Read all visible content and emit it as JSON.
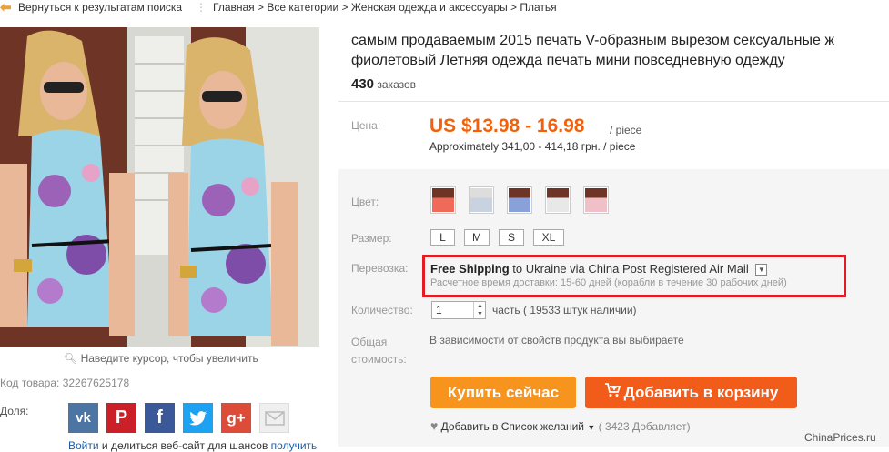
{
  "topbar": {
    "back_label": "Вернуться к результатам поиска",
    "breadcrumb": "Главная > Все категории > Женская одежда и аксессуары > Платья"
  },
  "gallery": {
    "zoom_hint": "Наведите курсор, чтобы увеличить",
    "code": "Код товара: 32267625178",
    "share_label": "Доля:",
    "share_icons": [
      "vk-icon",
      "pinterest-icon",
      "facebook-icon",
      "twitter-icon",
      "google-plus-icon",
      "email-icon"
    ],
    "bottom_login": "Войти",
    "bottom_text": " и делиться веб-сайт для шансов ",
    "bottom_get": "получить"
  },
  "product": {
    "title_line1": "самым продаваемым 2015 печать V-образным вырезом сексуальные ж",
    "title_line2": "фиолетовый Летняя одежда печать мини повседневную одежду",
    "orders_count": "430",
    "orders_label": "заказов"
  },
  "price": {
    "label": "Цена:",
    "value": "US $13.98 - 16.98",
    "unit": "/ piece",
    "approx": "Approximately 341,00 - 414,18 грн. / piece"
  },
  "options": {
    "color_label": "Цвет:",
    "size_label": "Размер:",
    "sizes": [
      "L",
      "M",
      "S",
      "XL"
    ],
    "shipping_label": "Перевозка:",
    "shipping_free": "Free Shipping",
    "shipping_to": "to",
    "shipping_method": "Ukraine via China Post Registered Air Mail",
    "shipping_time": "Расчетное время доставки: 15-60 дней (корабли в течение 30 рабочих дней)",
    "qty_label": "Количество:",
    "qty_value": "1",
    "qty_stock": "часть ( 19533 штук наличии)",
    "total_label_1": "Общая",
    "total_label_2": "стоимость:",
    "total_value": "В зависимости от свойств продукта вы выбираете"
  },
  "actions": {
    "buy_now": "Купить сейчас",
    "add_to_cart": "Добавить в корзину",
    "wishlist": "Добавить в Список желаний",
    "wishlist_count": "( 3423 Добавляет)"
  },
  "watermark": "ChinaPrices.ru",
  "colors": {
    "price": "#f2600a",
    "buy_button": "#f7941d",
    "cart_button": "#f25c1b",
    "highlight_border": "#e41b23"
  }
}
